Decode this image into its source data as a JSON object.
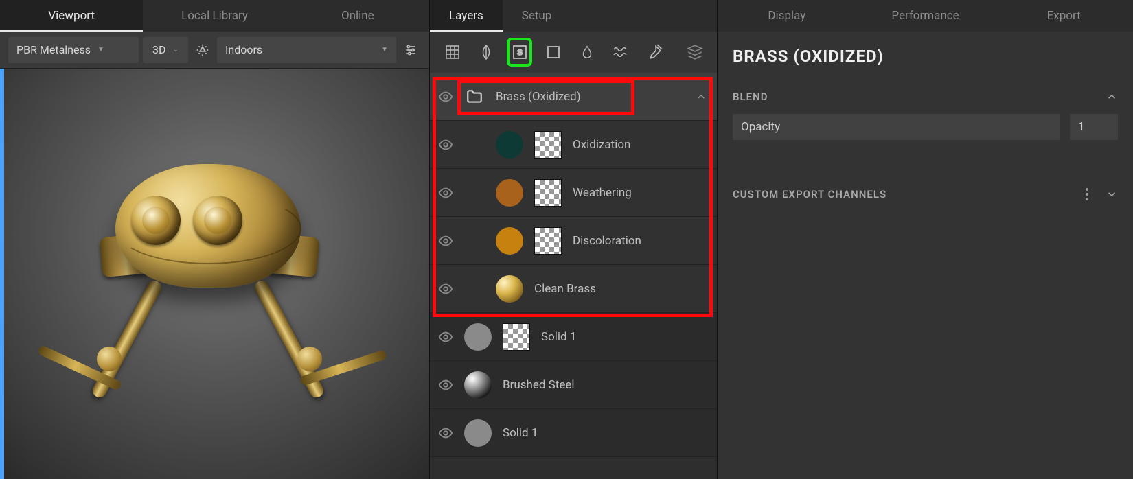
{
  "left": {
    "tabs": [
      "Viewport",
      "Local Library",
      "Online"
    ],
    "activeTab": 0,
    "shader_dropdown": "PBR Metalness",
    "view_mode": "3D",
    "environment": "Indoors"
  },
  "mid": {
    "tabs": [
      "Layers",
      "Setup"
    ],
    "activeTab": 0,
    "tools": [
      "grid",
      "leaf",
      "smart",
      "box",
      "drop",
      "wave",
      "brush",
      "stack"
    ],
    "selectedTool": 2,
    "group": {
      "name": "Brass (Oxidized)"
    },
    "children": [
      {
        "name": "Oxidization",
        "swatch": "#0e3a36",
        "hasMask": true
      },
      {
        "name": "Weathering",
        "swatch": "#a9621b",
        "hasMask": true
      },
      {
        "name": "Discoloration",
        "swatch": "#c6810f",
        "hasMask": true
      },
      {
        "name": "Clean Brass",
        "swatch": "gold",
        "hasMask": false
      }
    ],
    "below": [
      {
        "name": "Solid 1",
        "swatch": "#8a8a8a",
        "thumb": "mask"
      },
      {
        "name": "Brushed Steel",
        "swatch": "metal",
        "thumb": "none"
      },
      {
        "name": "Solid 1",
        "swatch": "#8a8a8a",
        "thumb": "none"
      }
    ]
  },
  "right": {
    "tabs": [
      "Display",
      "Performance",
      "Export"
    ],
    "title": "BRASS (OXIDIZED)",
    "blend": {
      "heading": "BLEND",
      "opacity_label": "Opacity",
      "opacity_value": "1"
    },
    "export": {
      "heading": "CUSTOM EXPORT CHANNELS"
    }
  }
}
